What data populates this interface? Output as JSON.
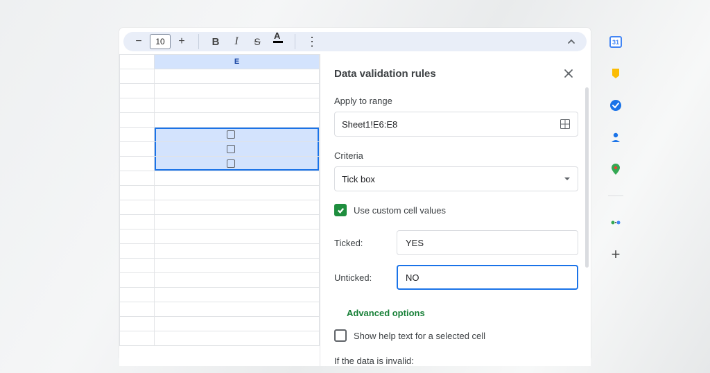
{
  "toolbar": {
    "font_size": "10"
  },
  "grid": {
    "column_label": "E"
  },
  "panel": {
    "title": "Data validation rules",
    "apply_label": "Apply to range",
    "range_value": "Sheet1!E6:E8",
    "criteria_label": "Criteria",
    "criteria_value": "Tick box",
    "custom_values_label": "Use custom cell values",
    "ticked_label": "Ticked:",
    "ticked_value": "YES",
    "unticked_label": "Unticked:",
    "unticked_value": "NO",
    "advanced_label": "Advanced options",
    "help_text_label": "Show help text for a selected cell",
    "invalid_label": "If the data is invalid:"
  }
}
